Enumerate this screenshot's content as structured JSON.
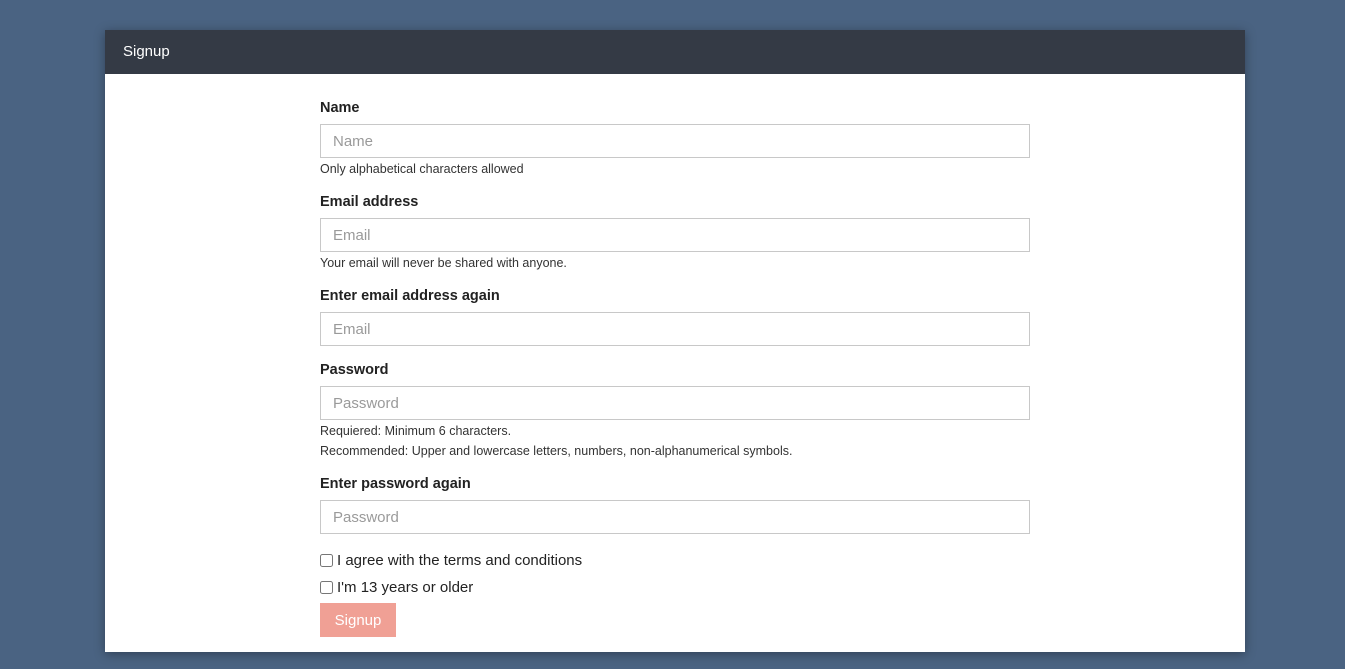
{
  "header": {
    "title": "Signup"
  },
  "form": {
    "name": {
      "label": "Name",
      "placeholder": "Name",
      "value": "",
      "help": "Only alphabetical characters allowed"
    },
    "email": {
      "label": "Email address",
      "placeholder": "Email",
      "value": "",
      "help": "Your email will never be shared with anyone."
    },
    "email_confirm": {
      "label": "Enter email address again",
      "placeholder": "Email",
      "value": ""
    },
    "password": {
      "label": "Password",
      "placeholder": "Password",
      "value": "",
      "help_required": "Requiered: Minimum 6 characters.",
      "help_recommended": "Recommended: Upper and lowercase letters, numbers, non-alphanumerical symbols."
    },
    "password_confirm": {
      "label": "Enter password again",
      "placeholder": "Password",
      "value": ""
    },
    "terms_checkbox": {
      "label": "I agree with the terms and conditions",
      "checked": false
    },
    "age_checkbox": {
      "label": "I'm 13 years or older",
      "checked": false
    },
    "submit_label": "Signup"
  },
  "colors": {
    "background": "#4a6382",
    "header": "#343a45",
    "button": "#f0a095"
  }
}
